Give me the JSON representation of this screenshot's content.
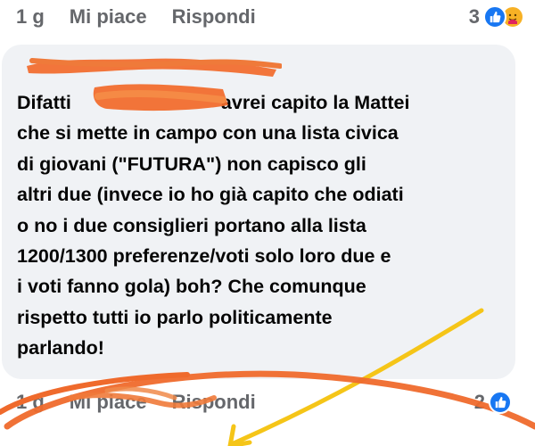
{
  "top_comment_actions": {
    "time": "1 g",
    "like_label": "Mi piace",
    "reply_label": "Rispondi",
    "reaction_count": "3",
    "reaction_icons": [
      "like-icon",
      "care-icon"
    ]
  },
  "comment": {
    "author": "",
    "lines": [
      "Difatti",
      "avrei capito la Mattei",
      "che si mette in campo con una lista civica",
      "di giovani (\"FUTURA\") non capisco gli",
      "altri due (invece io ho già capito che odiati",
      "o no i due consiglieri portano alla lista",
      "1200/1300 preferenze/voti solo loro due e",
      "i voti fanno gola) boh? Che comunque",
      "rispetto tutti io parlo politicamente",
      "parlando!"
    ]
  },
  "bottom_comment_actions": {
    "time": "1 g",
    "like_label": "Mi piace",
    "reply_label": "Rispondi",
    "reaction_count": "2",
    "reaction_icons": [
      "like-icon"
    ]
  },
  "colors": {
    "bubble_background": "#f0f2f5",
    "meta_text": "#65676b",
    "comment_text": "#050505",
    "like_blue": "#1877f2",
    "care_yellow": "#f7b125",
    "orange_marker": "#f26a2a",
    "yellow_marker": "#f5c518"
  }
}
